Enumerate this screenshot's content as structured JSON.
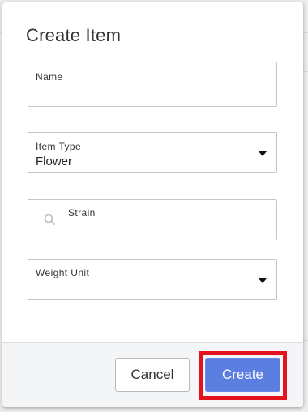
{
  "dialog": {
    "title": "Create Item"
  },
  "fields": {
    "name": {
      "label": "Name",
      "value": ""
    },
    "item_type": {
      "label": "Item Type",
      "value": "Flower"
    },
    "strain": {
      "label": "Strain",
      "value": "",
      "icon": "search-icon"
    },
    "weight_unit": {
      "label": "Weight Unit",
      "value": ""
    }
  },
  "footer": {
    "cancel_label": "Cancel",
    "create_label": "Create"
  },
  "colors": {
    "primary_button": "#5b7fe0",
    "highlight": "#e3121c"
  }
}
